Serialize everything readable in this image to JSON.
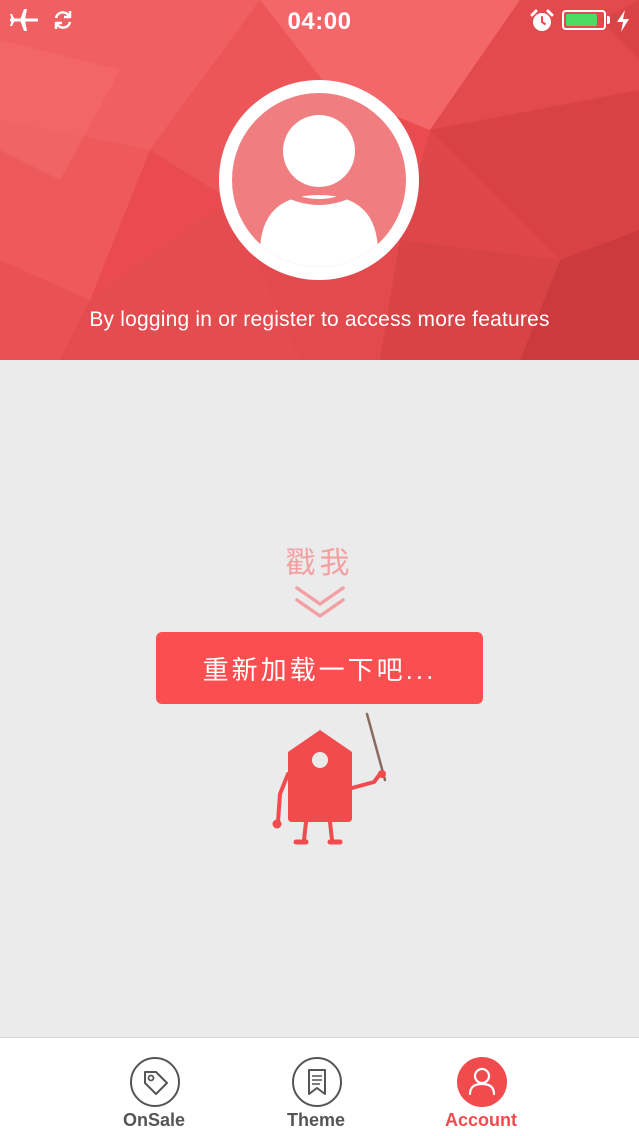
{
  "status_bar": {
    "time": "04:00",
    "battery_level": 0.85,
    "battery_color": "#4cd964",
    "icons": [
      "airplane-icon",
      "sync-icon",
      "alarm-icon",
      "battery-icon",
      "charging-bolt-icon"
    ]
  },
  "header": {
    "avatar_icon": "user-silhouette-icon",
    "login_prompt": "By logging in or register to access more features",
    "background_color": "#e94b4e"
  },
  "reload": {
    "poke_label": "戳我",
    "button_label": "重新加载一下吧...",
    "button_color": "#fa4e50",
    "mascot_icon": "price-tag-mascot-icon"
  },
  "tab_bar": {
    "active_color": "#f24b4e",
    "tabs": [
      {
        "label": "OnSale",
        "icon": "tag-icon",
        "active": false
      },
      {
        "label": "Theme",
        "icon": "bookmark-icon",
        "active": false
      },
      {
        "label": "Account",
        "icon": "user-icon",
        "active": true
      }
    ]
  }
}
